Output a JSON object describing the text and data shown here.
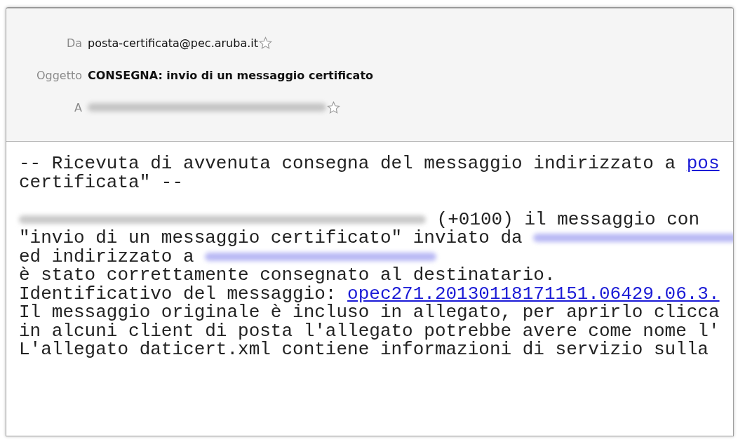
{
  "header": {
    "fields": [
      {
        "label": "Da",
        "kind": "address",
        "value": "posta-certificata@pec.aruba.it"
      },
      {
        "label": "Oggetto",
        "kind": "subject",
        "value": "CONSEGNA: invio di un messaggio certificato"
      },
      {
        "label": "A",
        "kind": "redacted-address"
      }
    ]
  },
  "body": {
    "lines": [
      {
        "kind": "text",
        "segments": [
          {
            "kind": "text",
            "text": "-- Ricevuta di avvenuta consegna del messaggio indirizzato a "
          },
          {
            "kind": "link",
            "text": "pos"
          }
        ]
      },
      {
        "kind": "text",
        "segments": [
          {
            "kind": "text",
            "text": "certificata\" --"
          }
        ]
      },
      {
        "kind": "blank"
      },
      {
        "kind": "text",
        "segments": [
          {
            "kind": "redacted"
          },
          {
            "kind": "text",
            "text": " (+0100) il messaggio con"
          }
        ]
      },
      {
        "kind": "text",
        "segments": [
          {
            "kind": "text",
            "text": "\"invio di un messaggio certificato\" inviato da "
          },
          {
            "kind": "redacted-link"
          }
        ]
      },
      {
        "kind": "text",
        "segments": [
          {
            "kind": "text",
            "text": "ed indirizzato a "
          },
          {
            "kind": "redacted-link"
          }
        ]
      },
      {
        "kind": "text",
        "segments": [
          {
            "kind": "text",
            "text": "è stato correttamente consegnato al destinatario."
          }
        ]
      },
      {
        "kind": "text",
        "segments": [
          {
            "kind": "text",
            "text": "Identificativo del messaggio: "
          },
          {
            "kind": "link",
            "text": "opec271.20130118171151.06429.06.3."
          }
        ]
      },
      {
        "kind": "text",
        "segments": [
          {
            "kind": "text",
            "text": "Il messaggio originale è incluso in allegato, per aprirlo clicca"
          }
        ]
      },
      {
        "kind": "text",
        "segments": [
          {
            "kind": "text",
            "text": "in alcuni client di posta l'allegato potrebbe avere come nome l'"
          }
        ]
      },
      {
        "kind": "text",
        "segments": [
          {
            "kind": "text",
            "text": "L'allegato daticert.xml contiene informazioni di servizio sulla"
          }
        ]
      }
    ]
  }
}
